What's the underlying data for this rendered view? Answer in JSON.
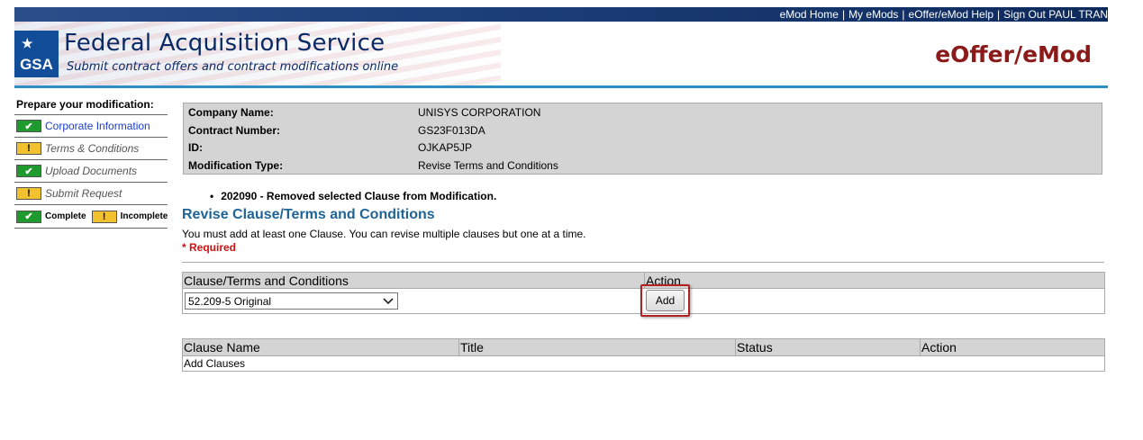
{
  "header": {
    "links": [
      "eMod Home",
      "My eMods",
      "eOffer/eMod Help",
      "Sign Out PAUL TRAN"
    ],
    "logo_text": "GSA",
    "org_title": "Federal Acquisition Service",
    "org_subtitle": "Submit contract offers and contract modifications online",
    "app_title": "eOffer/eMod",
    "accent_color": "#2e8fc4",
    "app_title_color": "#8b1a1a"
  },
  "sidebar": {
    "heading": "Prepare your modification:",
    "items": [
      {
        "label": "Corporate Information",
        "status": "complete",
        "icon": "checkmark-icon"
      },
      {
        "label": "Terms & Conditions",
        "status": "incomplete",
        "icon": "exclamation-icon"
      },
      {
        "label": "Upload Documents",
        "status": "complete",
        "icon": "checkmark-icon"
      },
      {
        "label": "Submit Request",
        "status": "incomplete",
        "icon": "exclamation-icon"
      }
    ],
    "legend": {
      "complete": "Complete",
      "incomplete": "Incomplete"
    }
  },
  "info": {
    "rows": [
      {
        "key": "Company Name:",
        "value": "UNISYS CORPORATION"
      },
      {
        "key": "Contract Number:",
        "value": "GS23F013DA"
      },
      {
        "key": "ID:",
        "value": "OJKAP5JP"
      },
      {
        "key": "Modification Type:",
        "value": "Revise Terms and Conditions"
      }
    ]
  },
  "message": "202090 - Removed selected Clause from Modification.",
  "section_title": "Revise Clause/Terms and Conditions",
  "instructions": "You must add at least one Clause. You can revise multiple clauses but one at a time.",
  "required_note": "* Required",
  "clause_table": {
    "col_clause": "Clause/Terms and Conditions",
    "col_action": "Action",
    "selected_option": "52.209-5 Original",
    "add_label": "Add"
  },
  "list_table": {
    "columns": [
      "Clause Name",
      "Title",
      "Status",
      "Action"
    ],
    "empty_text": "Add Clauses"
  }
}
